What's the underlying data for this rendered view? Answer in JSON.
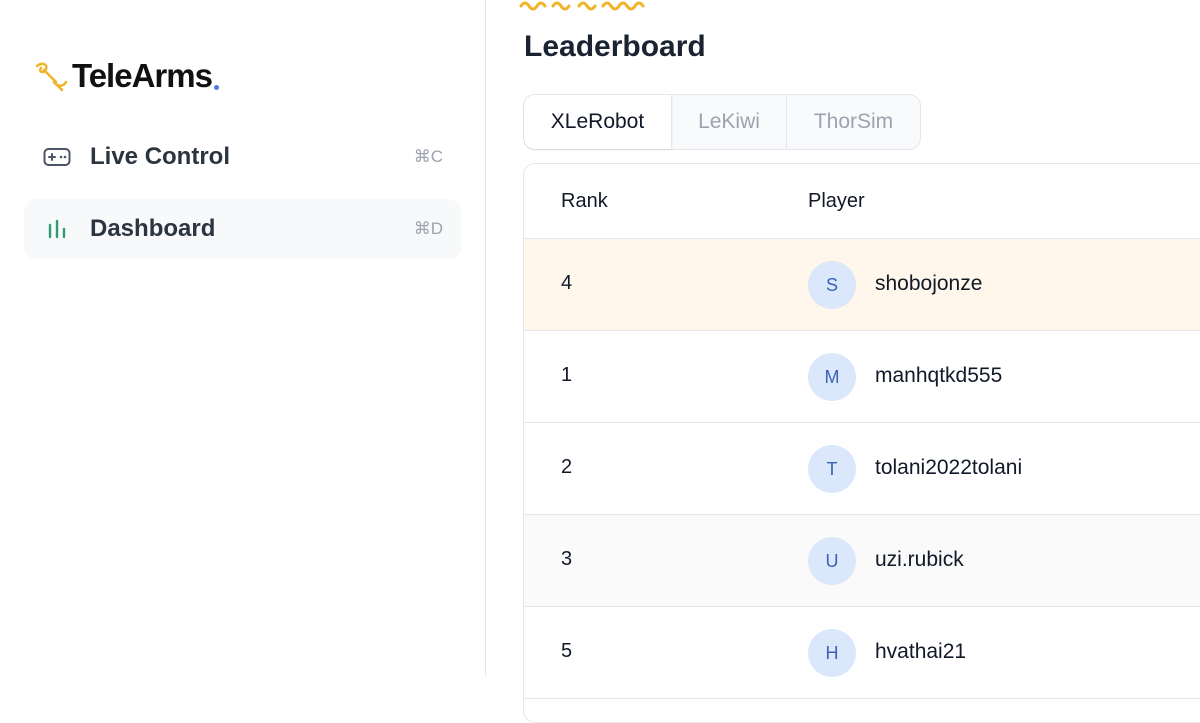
{
  "brand": {
    "name": "TeleArms",
    "accent": "#4f7be8",
    "logo_color": "#f0b429"
  },
  "sidebar": {
    "items": [
      {
        "label": "Live Control",
        "shortcut": "⌘C",
        "icon": "gamepad-icon",
        "active": false
      },
      {
        "label": "Dashboard",
        "shortcut": "⌘D",
        "icon": "bar-chart-icon",
        "active": true
      }
    ]
  },
  "main": {
    "title": "Leaderboard",
    "tabs": [
      {
        "label": "XLeRobot",
        "active": true
      },
      {
        "label": "LeKiwi",
        "active": false
      },
      {
        "label": "ThorSim",
        "active": false
      }
    ],
    "table": {
      "columns": {
        "rank": "Rank",
        "player": "Player"
      },
      "rows": [
        {
          "rank": "4",
          "initial": "S",
          "player": "shobojonze",
          "highlight": true
        },
        {
          "rank": "1",
          "initial": "M",
          "player": "manhqtkd555",
          "highlight": false
        },
        {
          "rank": "2",
          "initial": "T",
          "player": "tolani2022tolani",
          "highlight": false
        },
        {
          "rank": "3",
          "initial": "U",
          "player": "uzi.rubick",
          "highlight": false
        },
        {
          "rank": "5",
          "initial": "H",
          "player": "hvathai21",
          "highlight": false
        }
      ]
    }
  }
}
